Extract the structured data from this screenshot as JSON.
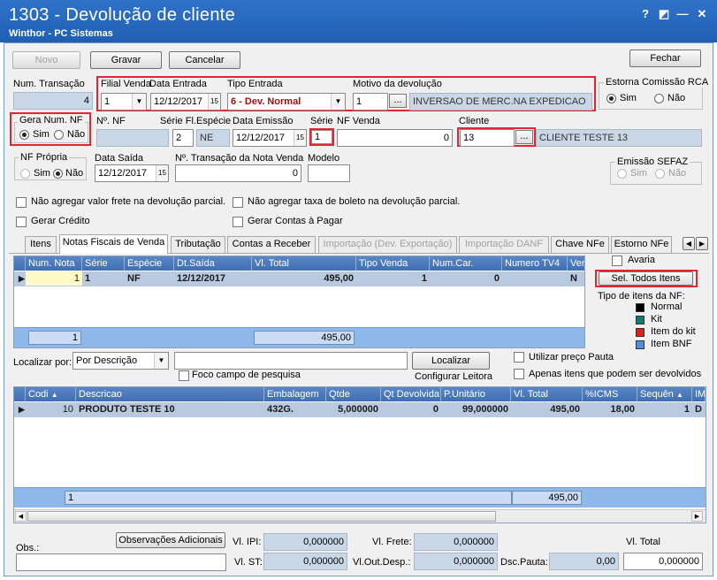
{
  "window": {
    "title": "1303 - Devolução de cliente",
    "subtitle": "Winthor - PC Sistemas",
    "controls": [
      "?",
      "◩",
      "—",
      "✕"
    ]
  },
  "toolbar": {
    "novo": "Novo",
    "gravar": "Gravar",
    "cancelar": "Cancelar",
    "fechar": "Fechar"
  },
  "header": {
    "num_transacao_label": "Num. Transação",
    "num_transacao": "4",
    "filial_label": "Filial Venda",
    "filial": "1",
    "data_entrada_label": "Data Entrada",
    "data_entrada": "12/12/2017",
    "tipo_entrada_label": "Tipo Entrada",
    "tipo_entrada": "6 - Dev. Normal",
    "motivo_label": "Motivo da devolução",
    "motivo_cod": "1",
    "motivo_desc": "INVERSAO DE MERC.NA EXPEDICAO",
    "estorna_label": "Estorna Comissão RCA",
    "sim": "Sim",
    "nao": "Não",
    "gera_num_nf_label": "Gera Num. NF",
    "nnf_label": "Nº. NF",
    "serie_fl_label": "Série Fl.",
    "especie_label": "Espécie",
    "serie_fl": "2",
    "especie": "NE",
    "data_emissao_label": "Data Emissão",
    "data_emissao": "12/12/2017",
    "serie_label": "Série",
    "serie": "1",
    "nf_venda_label": "NF Venda",
    "nf_venda": "0",
    "cliente_label": "Cliente",
    "cliente_cod": "13",
    "cliente_nome": "CLIENTE TESTE 13",
    "nf_propria_label": "NF Própria",
    "data_saida_label": "Data Saída",
    "data_saida": "12/12/2017",
    "ntrans_nota_label": "Nº. Transação da Nota Venda",
    "ntrans_nota": "0",
    "modelo_label": "Modelo",
    "emissao_sefaz_label": "Emissão SEFAZ",
    "chk_frete": "Não agregar valor frete na devolução parcial.",
    "chk_boleto": "Não agregar taxa de boleto na devolução parcial.",
    "chk_credito": "Gerar Crédito",
    "chk_contas": "Gerar Contas à Pagar"
  },
  "tabs": [
    "Itens",
    "Notas Fiscais de Venda",
    "Tributação",
    "Contas a Receber",
    "Importação (Dev. Exportação)",
    "Importação DANF",
    "Chave NFe",
    "Estorno NFe"
  ],
  "nf_grid": {
    "columns": [
      "Num. Nota",
      "Série",
      "Espécie",
      "Dt.Saída",
      "Vl. Total",
      "Tipo Venda",
      "Num.Car.",
      "Numero TV4",
      "Ver"
    ],
    "rows": [
      [
        "1",
        "1",
        "NF",
        "12/12/2017",
        "495,00",
        "1",
        "0",
        "",
        "N"
      ]
    ],
    "total_count": "1",
    "total_value": "495,00"
  },
  "side": {
    "avaria": "Avaria",
    "sel_todos": "Sel. Todos Itens",
    "tipo_label": "Tipo de itens da NF:",
    "legend": [
      {
        "label": "Normal",
        "color": "#000000"
      },
      {
        "label": "Kit",
        "color": "#127a6a"
      },
      {
        "label": "Item do kit",
        "color": "#e0201a"
      },
      {
        "label": "Item BNF",
        "color": "#4f8fe0"
      }
    ]
  },
  "search": {
    "localizar_por": "Localizar por:",
    "opcao": "Por Descrição",
    "localizar": "Localizar",
    "foco": "Foco campo de pesquisa",
    "configurar": "Configurar Leitora",
    "preco_pauta": "Utilizar preço Pauta",
    "apenas": "Apenas itens que podem ser devolvidos"
  },
  "item_grid": {
    "columns": [
      "Codi",
      "Descricao",
      "Embalagem",
      "Qtde",
      "Qt Devolvida",
      "P.Unitário",
      "Vl. Total",
      "%ICMS",
      "Sequên",
      "IMP"
    ],
    "rows": [
      [
        "10",
        "PRODUTO TESTE 10",
        "432G.",
        "5,000000",
        "0",
        "99,000000",
        "495,00",
        "18,00",
        "1",
        "D"
      ]
    ],
    "total_count": "1",
    "total_value": "495,00"
  },
  "footer": {
    "obs_label": "Obs.:",
    "obs_btn": "Observações Adicionais",
    "vl_ipi_label": "Vl. IPI:",
    "vl_ipi": "0,000000",
    "vl_st_label": "Vl. ST:",
    "vl_st": "0,000000",
    "vl_frete_label": "Vl. Frete:",
    "vl_frete": "0,000000",
    "vl_outdesp_label": "Vl.Out.Desp.:",
    "vl_outdesp": "0,000000",
    "vl_total_label": "Vl. Total",
    "dsc_pauta_label": "Dsc.Pauta:",
    "dsc_pauta": "0,00",
    "vl_total": "0,000000"
  }
}
